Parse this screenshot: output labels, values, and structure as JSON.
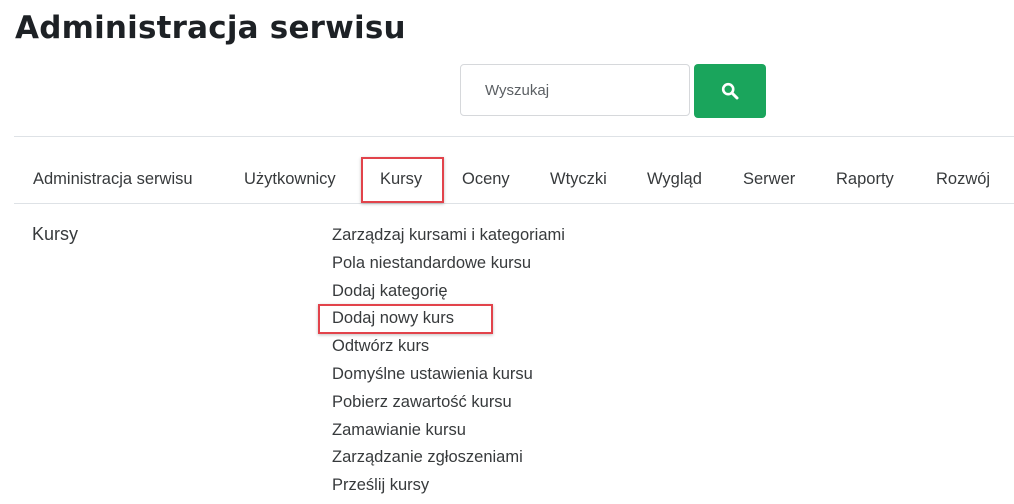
{
  "page": {
    "title": "Administracja serwisu"
  },
  "search": {
    "placeholder": "Wyszukaj",
    "button_icon": "search-icon",
    "button_color": "#1aa55c"
  },
  "tabs": [
    {
      "label": "Administracja serwisu"
    },
    {
      "label": "Użytkownicy"
    },
    {
      "label": "Kursy",
      "highlighted": true
    },
    {
      "label": "Oceny"
    },
    {
      "label": "Wtyczki"
    },
    {
      "label": "Wygląd"
    },
    {
      "label": "Serwer"
    },
    {
      "label": "Raporty"
    },
    {
      "label": "Rozwój"
    }
  ],
  "section": {
    "title": "Kursy",
    "links": [
      {
        "label": "Zarządzaj kursami i kategoriami"
      },
      {
        "label": "Pola niestandardowe kursu"
      },
      {
        "label": "Dodaj kategorię"
      },
      {
        "label": "Dodaj nowy kurs",
        "highlighted": true
      },
      {
        "label": "Odtwórz kurs"
      },
      {
        "label": "Domyślne ustawienia kursu"
      },
      {
        "label": "Pobierz zawartość kursu"
      },
      {
        "label": "Zamawianie kursu"
      },
      {
        "label": "Zarządzanie zgłoszeniami"
      },
      {
        "label": "Prześlij kursy"
      }
    ]
  },
  "colors": {
    "highlight": "#e2434b",
    "text": "#373a3c"
  }
}
